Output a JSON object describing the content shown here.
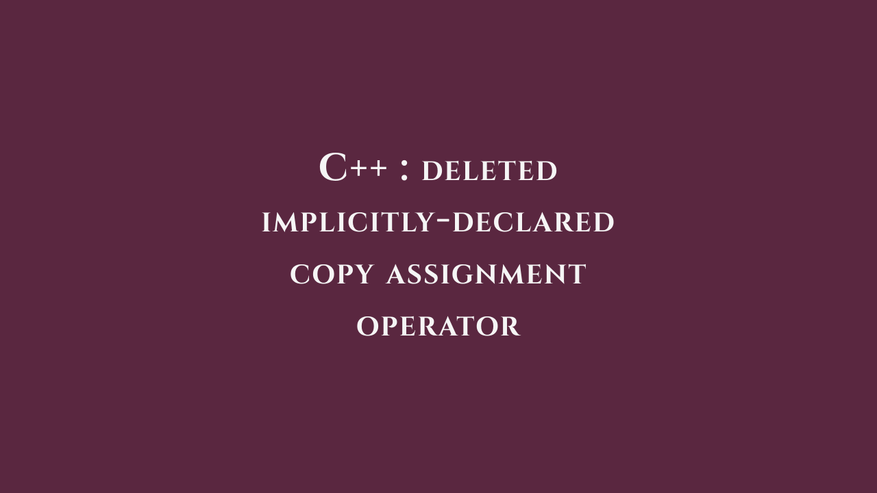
{
  "card": {
    "language": "C++",
    "separator": " : ",
    "title_lines": [
      "Deleted",
      "implicitly-declared",
      "copy assignment",
      "operator"
    ]
  },
  "colors": {
    "background": "#5a2740",
    "text": "#f5f5f5"
  }
}
